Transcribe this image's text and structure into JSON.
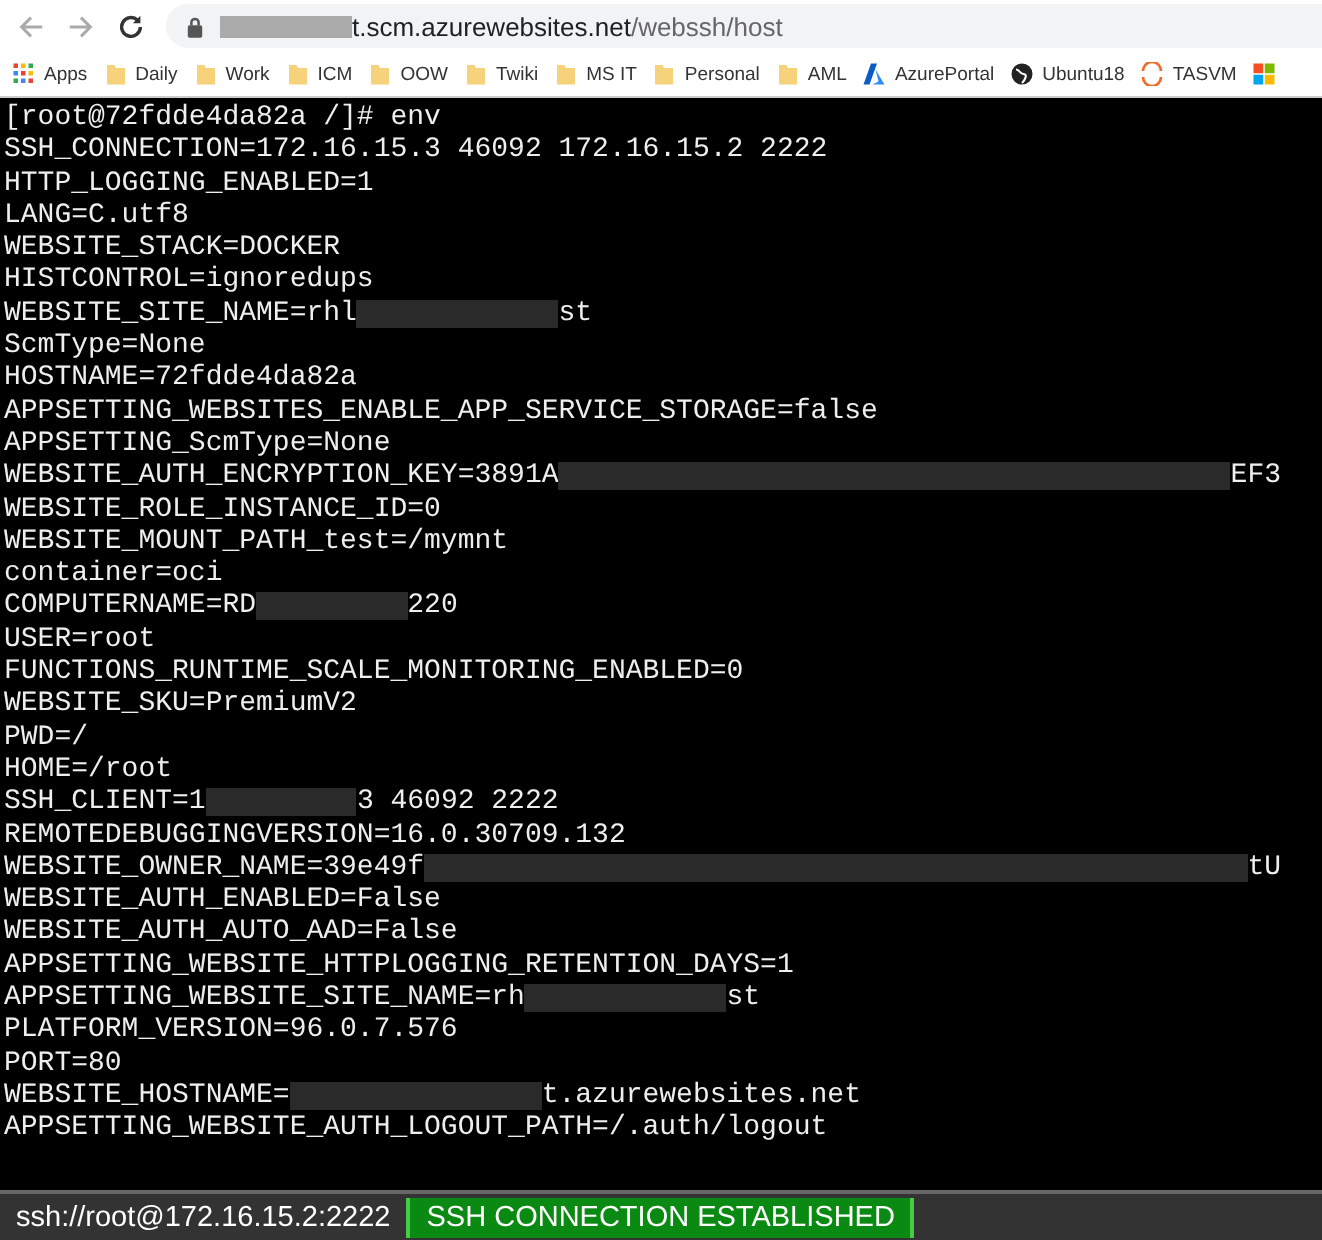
{
  "browser": {
    "url_host": "t.scm.azurewebsites.net",
    "url_path": "/webssh/host",
    "bookmarks": [
      {
        "kind": "apps",
        "label": "Apps"
      },
      {
        "kind": "folder",
        "label": "Daily"
      },
      {
        "kind": "folder",
        "label": "Work"
      },
      {
        "kind": "folder",
        "label": "ICM"
      },
      {
        "kind": "folder",
        "label": "OOW"
      },
      {
        "kind": "folder",
        "label": "Twiki"
      },
      {
        "kind": "folder",
        "label": "MS IT"
      },
      {
        "kind": "folder",
        "label": "Personal"
      },
      {
        "kind": "folder",
        "label": "AML"
      },
      {
        "kind": "azure",
        "label": "AzurePortal"
      },
      {
        "kind": "globe",
        "label": "Ubuntu18"
      },
      {
        "kind": "ring",
        "label": "TASVM"
      },
      {
        "kind": "squares"
      }
    ]
  },
  "terminal": {
    "lines": [
      {
        "segments": [
          {
            "kind": "text",
            "text": "[root@72fdde4da82a /]# env"
          }
        ]
      },
      {
        "segments": [
          {
            "kind": "text",
            "text": "SSH_CONNECTION=172.16.15.3 46092 172.16.15.2 2222"
          }
        ]
      },
      {
        "segments": [
          {
            "kind": "text",
            "text": "HTTP_LOGGING_ENABLED=1"
          }
        ]
      },
      {
        "segments": [
          {
            "kind": "text",
            "text": "LANG=C.utf8"
          }
        ]
      },
      {
        "segments": [
          {
            "kind": "text",
            "text": "WEBSITE_STACK=DOCKER"
          }
        ]
      },
      {
        "segments": [
          {
            "kind": "text",
            "text": "HISTCONTROL=ignoredups"
          }
        ]
      },
      {
        "segments": [
          {
            "kind": "text",
            "text": "WEBSITE_SITE_NAME=rhl"
          },
          {
            "kind": "redacted"
          },
          {
            "kind": "text",
            "text": "st"
          }
        ]
      },
      {
        "segments": [
          {
            "kind": "text",
            "text": "ScmType=None"
          }
        ]
      },
      {
        "segments": [
          {
            "kind": "text",
            "text": "HOSTNAME=72fdde4da82a"
          }
        ]
      },
      {
        "segments": [
          {
            "kind": "text",
            "text": "APPSETTING_WEBSITES_ENABLE_APP_SERVICE_STORAGE=false"
          }
        ]
      },
      {
        "segments": [
          {
            "kind": "text",
            "text": "APPSETTING_ScmType=None"
          }
        ]
      },
      {
        "segments": [
          {
            "kind": "text",
            "text": "WEBSITE_AUTH_ENCRYPTION_KEY=3891A"
          },
          {
            "kind": "redacted"
          },
          {
            "kind": "text",
            "text": "EF3"
          }
        ]
      },
      {
        "segments": [
          {
            "kind": "text",
            "text": "WEBSITE_ROLE_INSTANCE_ID=0"
          }
        ]
      },
      {
        "segments": [
          {
            "kind": "text",
            "text": "WEBSITE_MOUNT_PATH_test=/mymnt"
          }
        ]
      },
      {
        "segments": [
          {
            "kind": "text",
            "text": "container=oci"
          }
        ]
      },
      {
        "segments": [
          {
            "kind": "text",
            "text": "COMPUTERNAME=RD"
          },
          {
            "kind": "redacted"
          },
          {
            "kind": "text",
            "text": "220"
          }
        ]
      },
      {
        "segments": [
          {
            "kind": "text",
            "text": "USER=root"
          }
        ]
      },
      {
        "segments": [
          {
            "kind": "text",
            "text": "FUNCTIONS_RUNTIME_SCALE_MONITORING_ENABLED=0"
          }
        ]
      },
      {
        "segments": [
          {
            "kind": "text",
            "text": "WEBSITE_SKU=PremiumV2"
          }
        ]
      },
      {
        "segments": [
          {
            "kind": "text",
            "text": "PWD=/"
          }
        ]
      },
      {
        "segments": [
          {
            "kind": "text",
            "text": "HOME=/root"
          }
        ]
      },
      {
        "segments": [
          {
            "kind": "text",
            "text": "SSH_CLIENT=1"
          },
          {
            "kind": "redacted"
          },
          {
            "kind": "text",
            "text": "3 46092 2222"
          }
        ]
      },
      {
        "segments": [
          {
            "kind": "text",
            "text": "REMOTEDEBUGGINGVERSION=16.0.30709.132"
          }
        ]
      },
      {
        "segments": [
          {
            "kind": "text",
            "text": "WEBSITE_OWNER_NAME=39e49f"
          },
          {
            "kind": "redacted"
          },
          {
            "kind": "text",
            "text": "tU"
          }
        ]
      },
      {
        "segments": [
          {
            "kind": "text",
            "text": "WEBSITE_AUTH_ENABLED=False"
          }
        ]
      },
      {
        "segments": [
          {
            "kind": "text",
            "text": "WEBSITE_AUTH_AUTO_AAD=False"
          }
        ]
      },
      {
        "segments": [
          {
            "kind": "text",
            "text": "APPSETTING_WEBSITE_HTTPLOGGING_RETENTION_DAYS=1"
          }
        ]
      },
      {
        "segments": [
          {
            "kind": "text",
            "text": "APPSETTING_WEBSITE_SITE_NAME=rh"
          },
          {
            "kind": "redacted"
          },
          {
            "kind": "text",
            "text": "st"
          }
        ]
      },
      {
        "segments": [
          {
            "kind": "text",
            "text": "PLATFORM_VERSION=96.0.7.576"
          }
        ]
      },
      {
        "segments": [
          {
            "kind": "text",
            "text": "PORT=80"
          }
        ]
      },
      {
        "segments": [
          {
            "kind": "text",
            "text": "WEBSITE_HOSTNAME="
          },
          {
            "kind": "redacted"
          },
          {
            "kind": "text",
            "text": "t.azurewebsites.net"
          }
        ]
      },
      {
        "segments": [
          {
            "kind": "text",
            "text": "APPSETTING_WEBSITE_AUTH_LOGOUT_PATH=/.auth/logout"
          }
        ]
      }
    ]
  },
  "status_bar": {
    "address": "ssh://root@172.16.15.2:2222",
    "status": "SSH CONNECTION ESTABLISHED"
  }
}
